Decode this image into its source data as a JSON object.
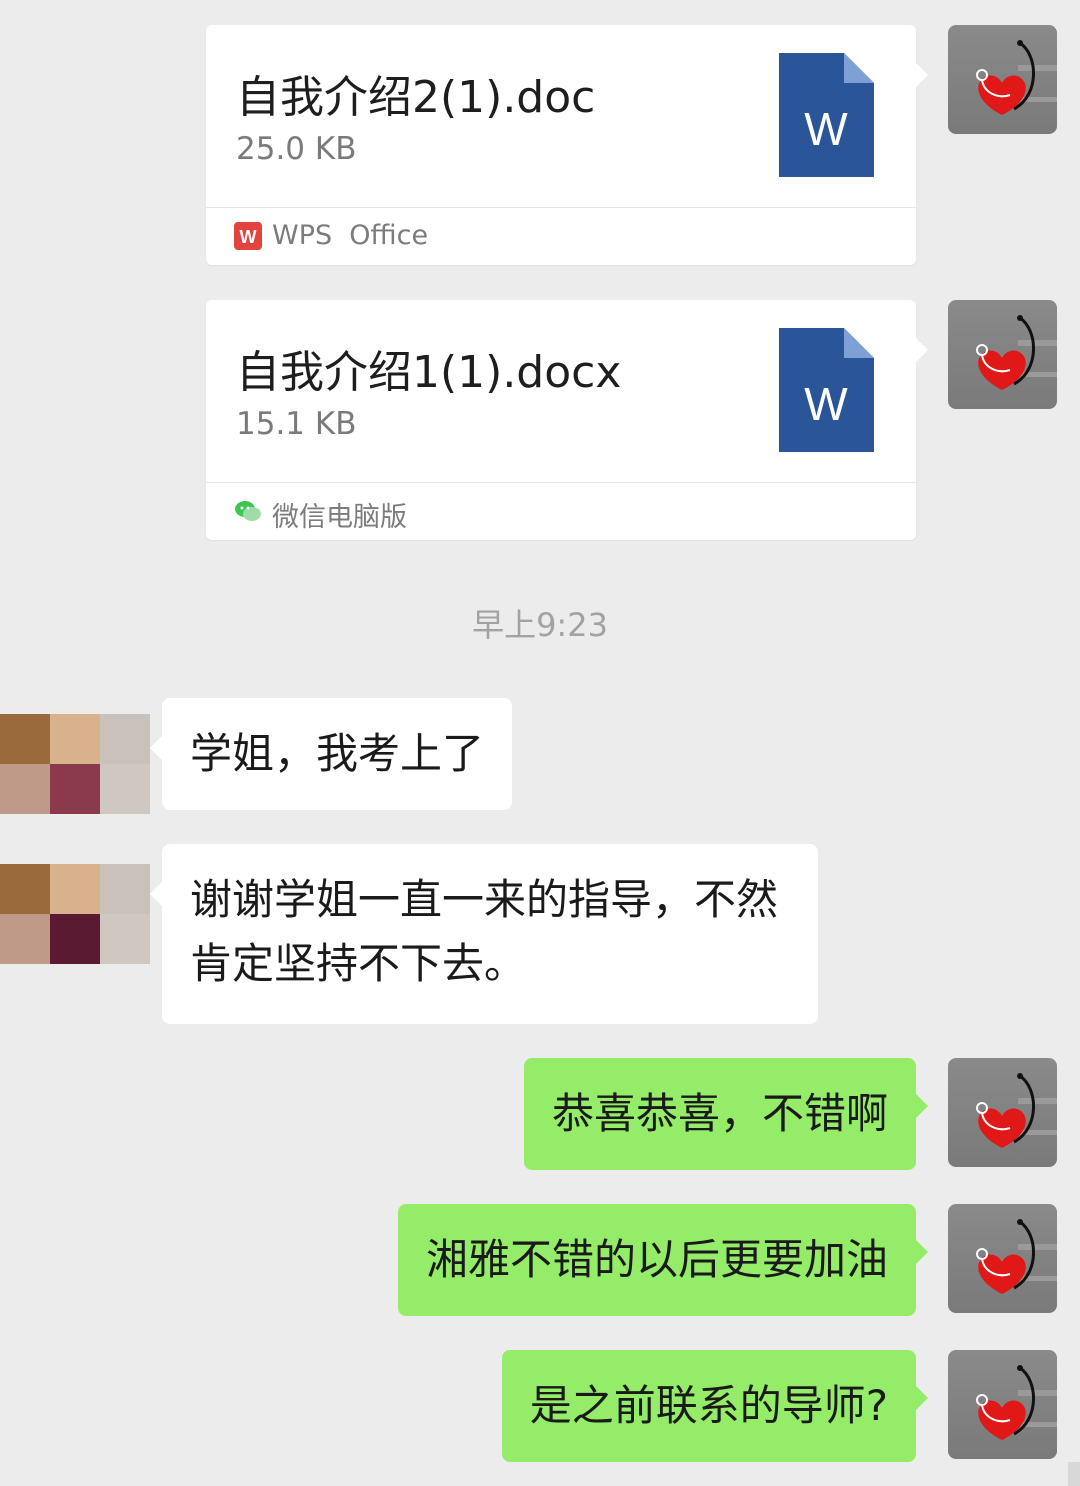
{
  "colors": {
    "background": "#ececec",
    "sent_bubble": "#95ec69",
    "received_bubble": "#ffffff",
    "word_icon": "#2a5699",
    "wps_icon": "#e2433f",
    "wechat_icon": "#3ec654"
  },
  "messages": {
    "file1": {
      "name": "自我介绍2(1).doc",
      "size": "25.0 KB",
      "source": "WPS  Office",
      "icon": "word-doc-icon",
      "source_icon": "wps-office-icon"
    },
    "file2": {
      "name": "自我介绍1(1).docx",
      "size": "15.1 KB",
      "source": "微信电脑版",
      "icon": "word-doc-icon",
      "source_icon": "wechat-pc-icon"
    },
    "timestamp": "早上9:23",
    "received1": "学姐，我考上了",
    "received2_line1": "谢谢学姐一直一来的指导，不然",
    "received2_line2": "肯定坚持不下去。",
    "sent1": "恭喜恭喜，不错啊",
    "sent2": "湘雅不错的以后更要加油",
    "sent3": "是之前联系的导师?"
  },
  "icons": {
    "word_letter": "W",
    "wps_letter": "W"
  }
}
